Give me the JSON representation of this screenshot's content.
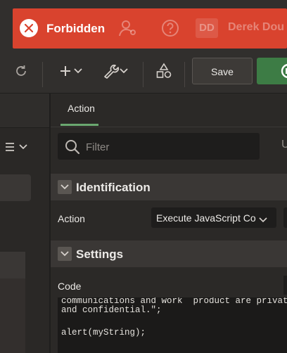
{
  "toast": {
    "title": "Forbidden",
    "behind": {
      "avatar_initials": "DD",
      "user_name": "Derek Dou"
    }
  },
  "toolbar": {
    "save_label": "Save"
  },
  "panel": {
    "tab_label": "Action",
    "filter_placeholder": "Filter",
    "filter_extra": "U"
  },
  "regions": {
    "identification": {
      "title": "Identification",
      "action_label": "Action",
      "action_value": "Execute JavaScript Co"
    },
    "settings": {
      "title": "Settings",
      "code_label": "Code"
    }
  },
  "code": {
    "lines": [
      "communications and work  product are private",
      "and confidential.\";",
      "",
      "alert(myString);"
    ]
  },
  "colors": {
    "toast": "#d9432e",
    "accent_green": "#3d7c45",
    "tab_underline": "#6aa870"
  }
}
